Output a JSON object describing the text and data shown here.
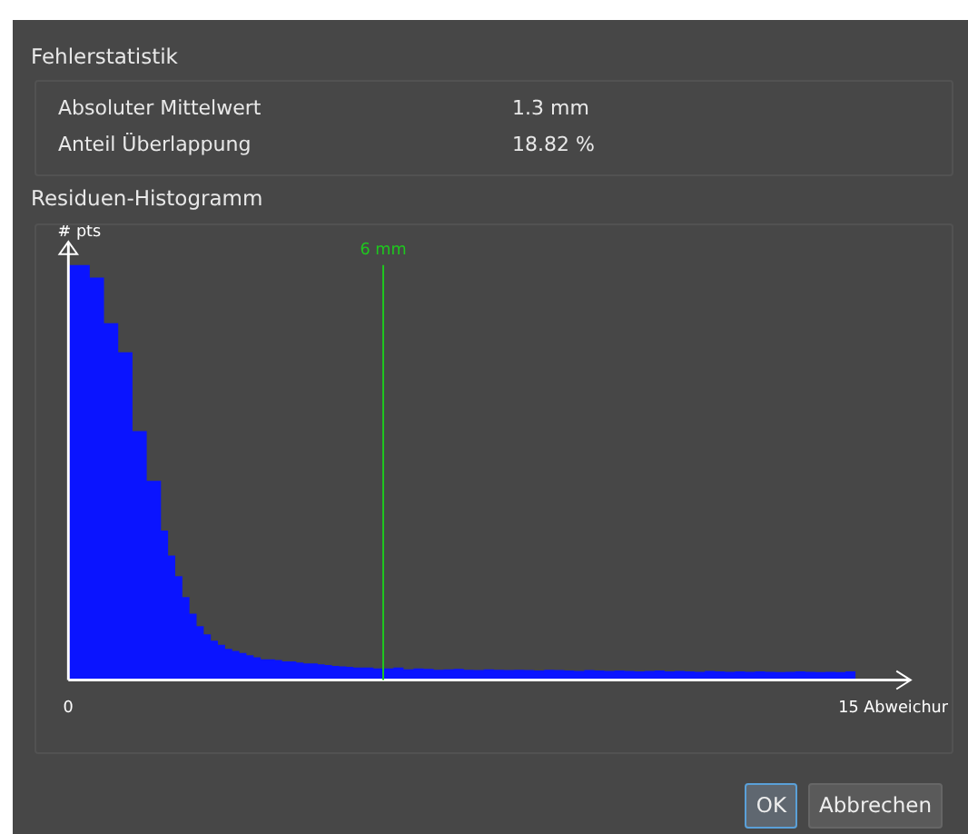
{
  "sections": [
    {
      "title": "Fehlerstatistik",
      "rows": [
        {
          "label": "Absoluter Mittelwert",
          "value": "1.3 mm"
        },
        {
          "label": "Anteil Überlappung",
          "value": "18.82 %"
        }
      ]
    },
    {
      "title": "Residuen-Histogramm",
      "histogram": {
        "y_axis_label": "# pts",
        "x_start_label": "0",
        "x_end_label": "15 Abweichur",
        "marker_label": "6 mm"
      }
    }
  ],
  "buttons": [
    {
      "label": "OK",
      "selected": true
    },
    {
      "label": "Abbrechen",
      "selected": false
    }
  ]
}
